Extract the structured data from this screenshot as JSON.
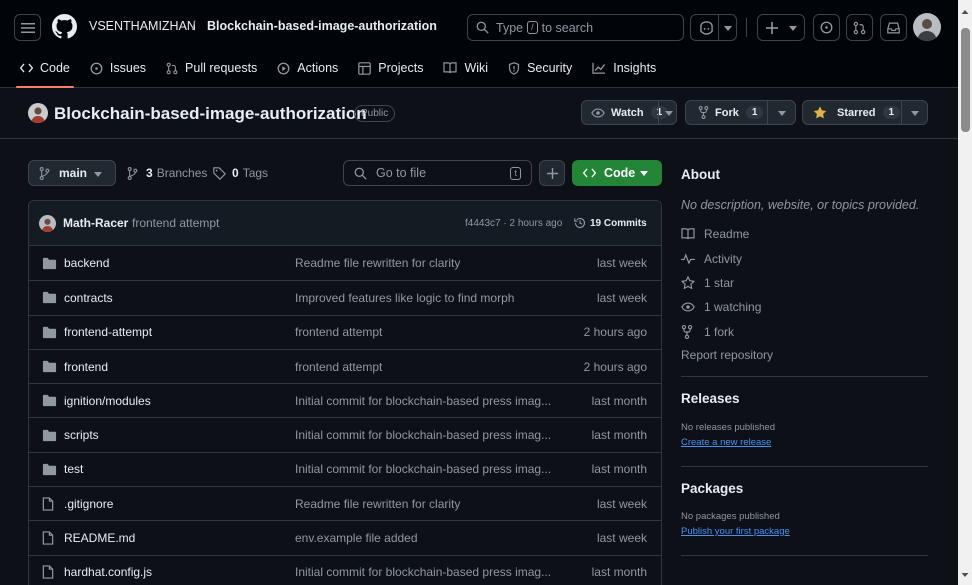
{
  "header": {
    "owner": "VSENTHAMIZHAN",
    "separator": "/",
    "repo": "Blockchain-based-image-authorization",
    "search_prefix": "Type",
    "search_key": "/",
    "search_suffix": "to search"
  },
  "tabs": [
    {
      "label": "Code",
      "icon": "code-icon"
    },
    {
      "label": "Issues",
      "icon": "issue-icon"
    },
    {
      "label": "Pull requests",
      "icon": "pull-request-icon"
    },
    {
      "label": "Actions",
      "icon": "play-icon"
    },
    {
      "label": "Projects",
      "icon": "table-icon"
    },
    {
      "label": "Wiki",
      "icon": "book-icon"
    },
    {
      "label": "Security",
      "icon": "shield-icon"
    },
    {
      "label": "Insights",
      "icon": "graph-icon"
    }
  ],
  "repo": {
    "title": "Blockchain-based-image-authorization",
    "visibility": "Public",
    "watch_label": "Watch",
    "watch_count": "1",
    "fork_label": "Fork",
    "fork_count": "1",
    "star_label": "Starred",
    "star_count": "1"
  },
  "toolbar": {
    "branch": "main",
    "branches_count": "3",
    "branches_label": "Branches",
    "tags_count": "0",
    "tags_label": "Tags",
    "goto_placeholder": "Go to file",
    "goto_key": "t",
    "code_label": "Code"
  },
  "commit": {
    "author": "Math-Racer",
    "message": "frontend attempt",
    "hash_time": "f4443c7 · 2 hours ago",
    "commits_label": "19 Commits"
  },
  "files": [
    {
      "name": "backend",
      "type": "folder",
      "message": "Readme file rewritten for clarity",
      "when": "last week"
    },
    {
      "name": "contracts",
      "type": "folder",
      "message": "Improved features like logic to find morph",
      "when": "last week"
    },
    {
      "name": "frontend-attempt",
      "type": "folder",
      "message": "frontend attempt",
      "when": "2 hours ago"
    },
    {
      "name": "frontend",
      "type": "folder",
      "message": "frontend attempt",
      "when": "2 hours ago"
    },
    {
      "name": "ignition/modules",
      "type": "folder",
      "message": "Initial commit for blockchain-based press imag...",
      "when": "last month"
    },
    {
      "name": "scripts",
      "type": "folder",
      "message": "Initial commit for blockchain-based press imag...",
      "when": "last month"
    },
    {
      "name": "test",
      "type": "folder",
      "message": "Initial commit for blockchain-based press imag...",
      "when": "last month"
    },
    {
      "name": ".gitignore",
      "type": "file",
      "message": "Readme file rewritten for clarity",
      "when": "last week"
    },
    {
      "name": "README.md",
      "type": "file",
      "message": "env.example file added",
      "when": "last week"
    },
    {
      "name": "hardhat.config.js",
      "type": "file",
      "message": "Initial commit for blockchain-based press imag...",
      "when": "last month"
    }
  ],
  "about": {
    "title": "About",
    "description": "No description, website, or topics provided.",
    "links": [
      {
        "label": "Readme",
        "icon": "book-icon"
      },
      {
        "label": "Activity",
        "icon": "pulse-icon"
      },
      {
        "label": "1 star",
        "icon": "star-icon"
      },
      {
        "label": "1 watching",
        "icon": "eye-icon"
      },
      {
        "label": "1 fork",
        "icon": "fork-icon"
      }
    ],
    "report": "Report repository"
  },
  "releases": {
    "title": "Releases",
    "empty": "No releases published",
    "create": "Create a new release"
  },
  "packages": {
    "title": "Packages",
    "empty": "No packages published",
    "publish": "Publish your first package"
  },
  "colors": {
    "accent_green": "#238636",
    "link_blue": "#4493f8",
    "tab_underline": "#f78166",
    "star_yellow": "#e3b341"
  }
}
